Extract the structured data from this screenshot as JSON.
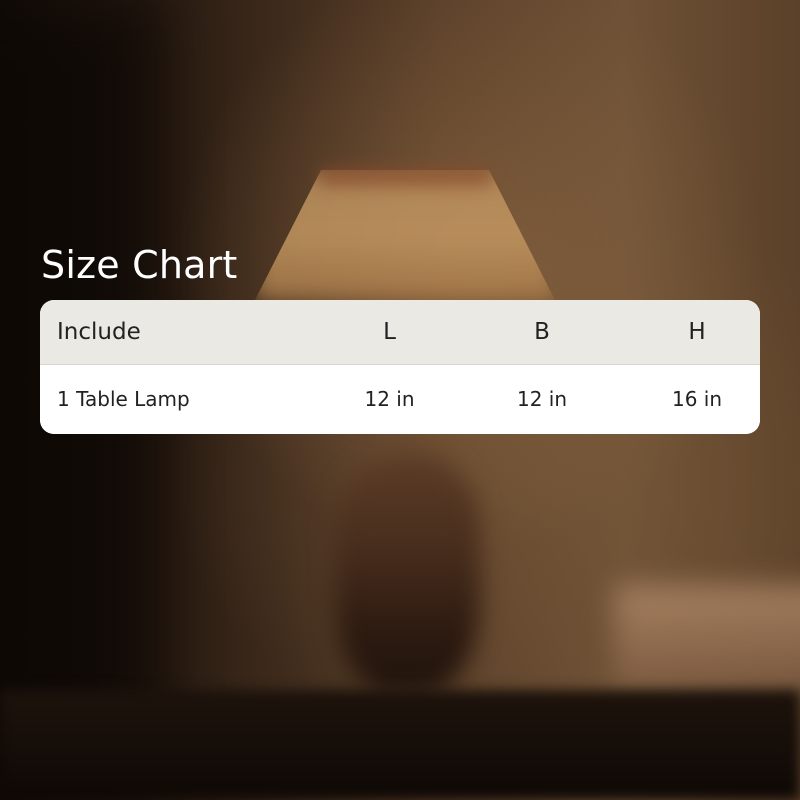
{
  "title": "Size Chart",
  "table": {
    "headers": {
      "include": "Include",
      "l": "L",
      "b": "B",
      "h": "H"
    },
    "rows": [
      {
        "include": "1 Table Lamp",
        "l": "12 in",
        "b": "12 in",
        "h": "16 in"
      }
    ]
  },
  "colors": {
    "header_background": "#ebe9e4",
    "row_background": "#ffffff",
    "text": "#222222",
    "title_text": "#ffffff"
  }
}
